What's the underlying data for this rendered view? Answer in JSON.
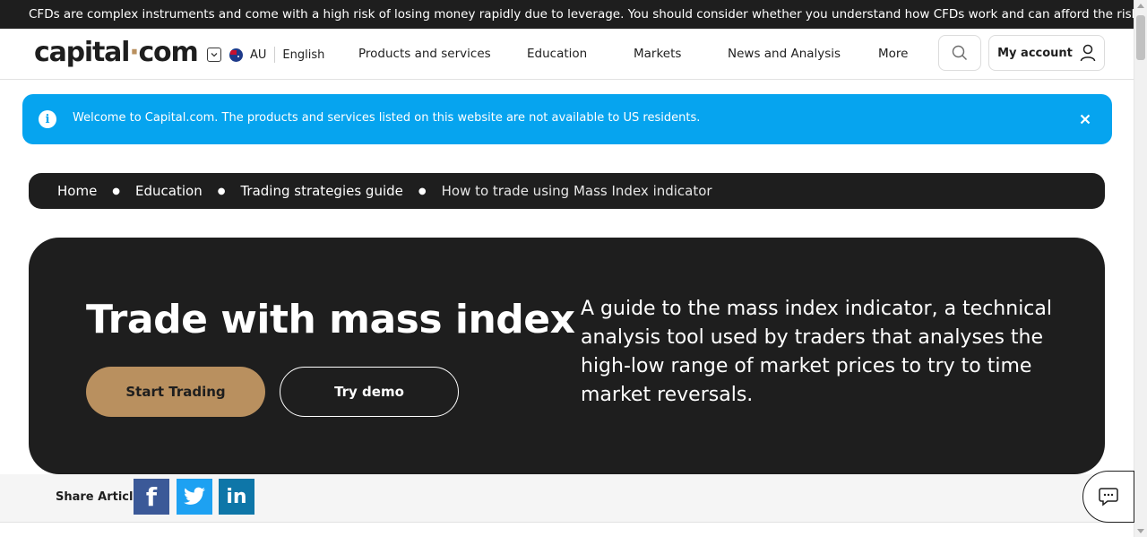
{
  "risk_warning": "CFDs are complex instruments and come with a high risk of losing money rapidly due to leverage. You should consider whether you understand how CFDs work and can afford the risks.",
  "header": {
    "logo_text_main": "capital",
    "logo_text_dot": "·",
    "logo_text_end": "com",
    "region": "AU",
    "language": "English",
    "nav": [
      "Products and services",
      "Education",
      "Markets",
      "News and Analysis",
      "More"
    ],
    "account_label": "My account"
  },
  "notice": {
    "message": "Welcome to Capital.com. The products and services listed on this website are not available to US residents."
  },
  "breadcrumb": {
    "items": [
      "Home",
      "Education",
      "Trading strategies guide"
    ],
    "current": "How to trade using Mass Index indicator"
  },
  "hero": {
    "title": "Trade with mass index",
    "start_label": "Start Trading",
    "demo_label": "Try demo",
    "description": "A guide to the mass index indicator, a technical analysis tool used by traders that analyses the high-low range of market prices to try to time market reversals."
  },
  "share": {
    "label": "Share Article",
    "networks": [
      "facebook",
      "twitter",
      "linkedin"
    ]
  },
  "colors": {
    "dark": "#1e1e1e",
    "accent": "#b9905f",
    "notice_blue": "#06a4ef"
  }
}
